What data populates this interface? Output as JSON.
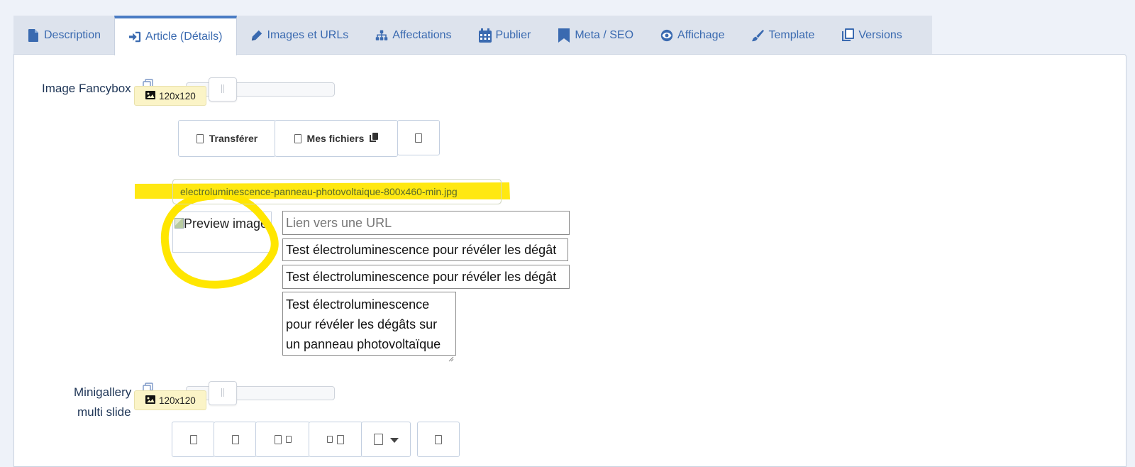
{
  "tabs": [
    {
      "label": "Description",
      "icon": "file-icon",
      "active": false
    },
    {
      "label": "Article (Détails)",
      "icon": "sign-in-icon",
      "active": true
    },
    {
      "label": "Images et URLs",
      "icon": "pencil-icon",
      "active": false
    },
    {
      "label": "Affectations",
      "icon": "sitemap-icon",
      "active": false
    },
    {
      "label": "Publier",
      "icon": "calendar-icon",
      "active": false
    },
    {
      "label": "Meta / SEO",
      "icon": "bookmark-icon",
      "active": false
    },
    {
      "label": "Affichage",
      "icon": "eye-icon",
      "active": false
    },
    {
      "label": "Template",
      "icon": "brush-icon",
      "active": false
    },
    {
      "label": "Versions",
      "icon": "copy-icon",
      "active": false
    }
  ],
  "fancybox": {
    "label": "Image Fancybox",
    "size_badge": "120x120",
    "upload_label": "Transférer",
    "myfiles_label": "Mes fichiers",
    "filename": "electroluminescence-panneau-photovoltaique-800x460-min.jpg",
    "preview_alt": "Preview image",
    "url_placeholder": "Lien vers une URL",
    "alt_value": "Test électroluminescence pour révéler les dégât",
    "title_value": "Test électroluminescence pour révéler les dégât",
    "caption_value": "Test électroluminescence pour révéler les dégâts sur un panneau photovoltaïque"
  },
  "minigallery": {
    "label_line1": "Minigallery",
    "label_line2": "multi slide",
    "size_badge": "120x120"
  },
  "colors": {
    "accent": "#4a7cc4",
    "highlight": "#ffe600",
    "tab_bar": "#dde3ed"
  }
}
